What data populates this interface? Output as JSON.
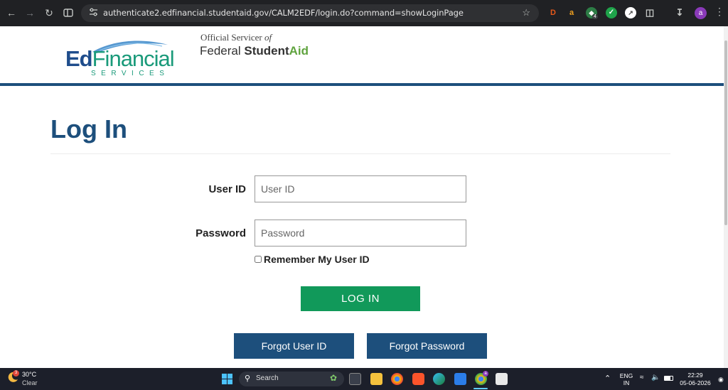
{
  "browser": {
    "url": "authenticate2.edfinancial.studentaid.gov/CALM2EDF/login.do?command=showLoginPage",
    "profile_initial": "a",
    "extension_badge": "4"
  },
  "header": {
    "logo_main": "Ed",
    "logo_accent": "Financial",
    "logo_sub": "SERVICES",
    "official_prefix": "Official Servicer ",
    "official_of": "of",
    "fsa_federal": "Federal ",
    "fsa_student": "Student",
    "fsa_aid": "Aid"
  },
  "login": {
    "title": "Log In",
    "user_id_label": "User ID",
    "user_id_placeholder": "User ID",
    "password_label": "Password",
    "password_placeholder": "Password",
    "remember_label": "Remember My User ID",
    "login_button": "LOG IN",
    "forgot_user_id": "Forgot User ID",
    "forgot_password": "Forgot Password"
  },
  "taskbar": {
    "weather_temp": "30°C",
    "weather_cond": "Clear",
    "weather_badge": "3",
    "search_label": "Search",
    "lang_top": "ENG",
    "lang_bottom": "IN",
    "time": "22:29",
    "date": "05-06-2026",
    "chrome_badge": "a"
  },
  "colors": {
    "brand_blue": "#1d4f7c",
    "login_green": "#11995a",
    "fsa_green": "#5fa33e"
  }
}
